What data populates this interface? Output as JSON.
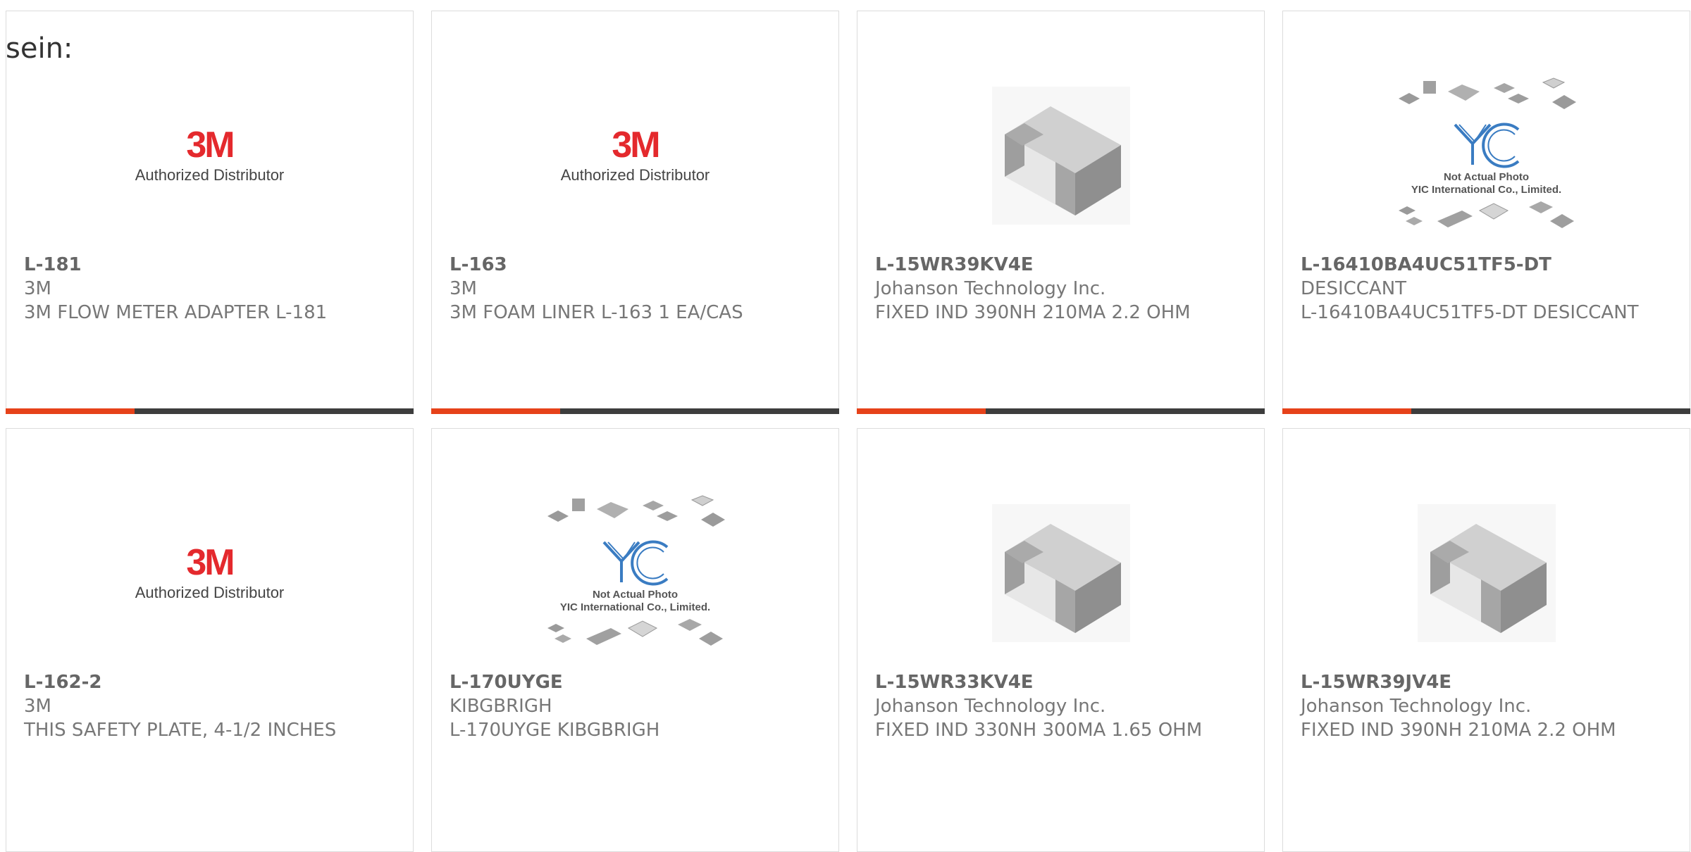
{
  "fragment_text": "sein:",
  "accent_color": "#e6421a",
  "products": [
    {
      "part": "L-181",
      "manufacturer": "3M",
      "desc": "3M FLOW METER ADAPTER L-181",
      "image": "3m",
      "logo_mark": "3M",
      "logo_text": "Authorized Distributor"
    },
    {
      "part": "L-163",
      "manufacturer": "3M",
      "desc": "3M FOAM LINER L-163 1 EA/CAS",
      "image": "3m",
      "logo_mark": "3M",
      "logo_text": "Authorized Distributor"
    },
    {
      "part": "L-15WR39KV4E",
      "manufacturer": "Johanson Technology Inc.",
      "desc": "FIXED IND 390NH 210MA 2.2 OHM",
      "image": "chip"
    },
    {
      "part": "L-16410BA4UC51TF5-DT",
      "manufacturer": "DESICCANT",
      "desc": "L-16410BA4UC51TF5-DT DESICCANT",
      "image": "yic",
      "yic_caption1": "Not Actual Photo",
      "yic_caption2": "YIC International Co., Limited."
    },
    {
      "part": "L-162-2",
      "manufacturer": "3M",
      "desc": "THIS SAFETY PLATE, 4-1/2 INCHES",
      "image": "3m",
      "logo_mark": "3M",
      "logo_text": "Authorized Distributor"
    },
    {
      "part": "L-170UYGE",
      "manufacturer": "KIBGBRIGH",
      "desc": "L-170UYGE KIBGBRIGH",
      "image": "yic",
      "yic_caption1": "Not Actual Photo",
      "yic_caption2": "YIC International Co., Limited."
    },
    {
      "part": "L-15WR33KV4E",
      "manufacturer": "Johanson Technology Inc.",
      "desc": "FIXED IND 330NH 300MA 1.65 OHM",
      "image": "chip"
    },
    {
      "part": "L-15WR39JV4E",
      "manufacturer": "Johanson Technology Inc.",
      "desc": "FIXED IND 390NH 210MA 2.2 OHM",
      "image": "chip"
    }
  ]
}
